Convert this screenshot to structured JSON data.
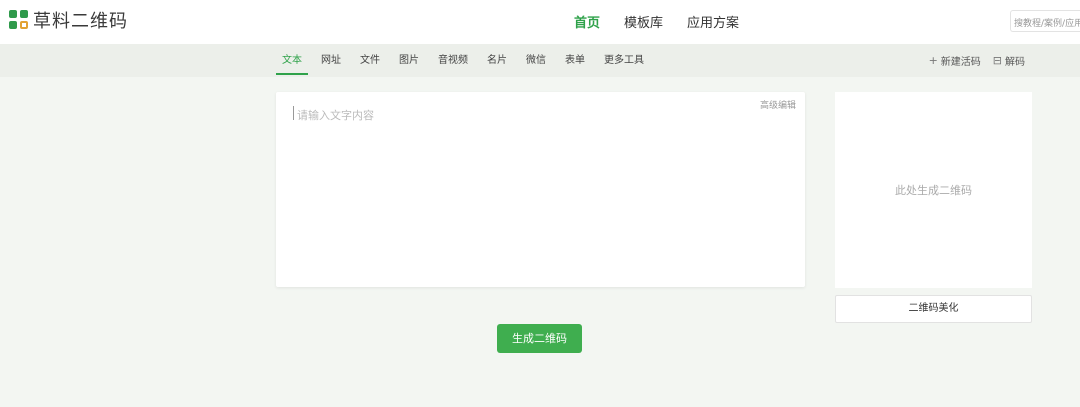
{
  "brand": {
    "name": "草料二维码"
  },
  "nav": [
    {
      "label": "首页",
      "active": true
    },
    {
      "label": "模板库",
      "active": false
    },
    {
      "label": "应用方案",
      "active": false
    }
  ],
  "search": {
    "placeholder": "搜教程/案例/应用"
  },
  "tabs": [
    {
      "label": "文本",
      "active": true
    },
    {
      "label": "网址"
    },
    {
      "label": "文件"
    },
    {
      "label": "图片"
    },
    {
      "label": "音视频"
    },
    {
      "label": "名片"
    },
    {
      "label": "微信"
    },
    {
      "label": "表单"
    },
    {
      "label": "更多工具"
    }
  ],
  "actions": {
    "new_live_code": "新建活码",
    "new_live_code_icon": "plus-icon",
    "decode": "解码",
    "decode_icon": "scan-icon"
  },
  "editor": {
    "placeholder": "请输入文字内容",
    "advanced_label": "高级编辑"
  },
  "generate_button": "生成二维码",
  "preview": {
    "hint": "此处生成二维码",
    "beautify_label": "二维码美化"
  },
  "colors": {
    "accent": "#2fa24a",
    "button": "#3fae4f",
    "page_bg": "#f3f6f2"
  }
}
